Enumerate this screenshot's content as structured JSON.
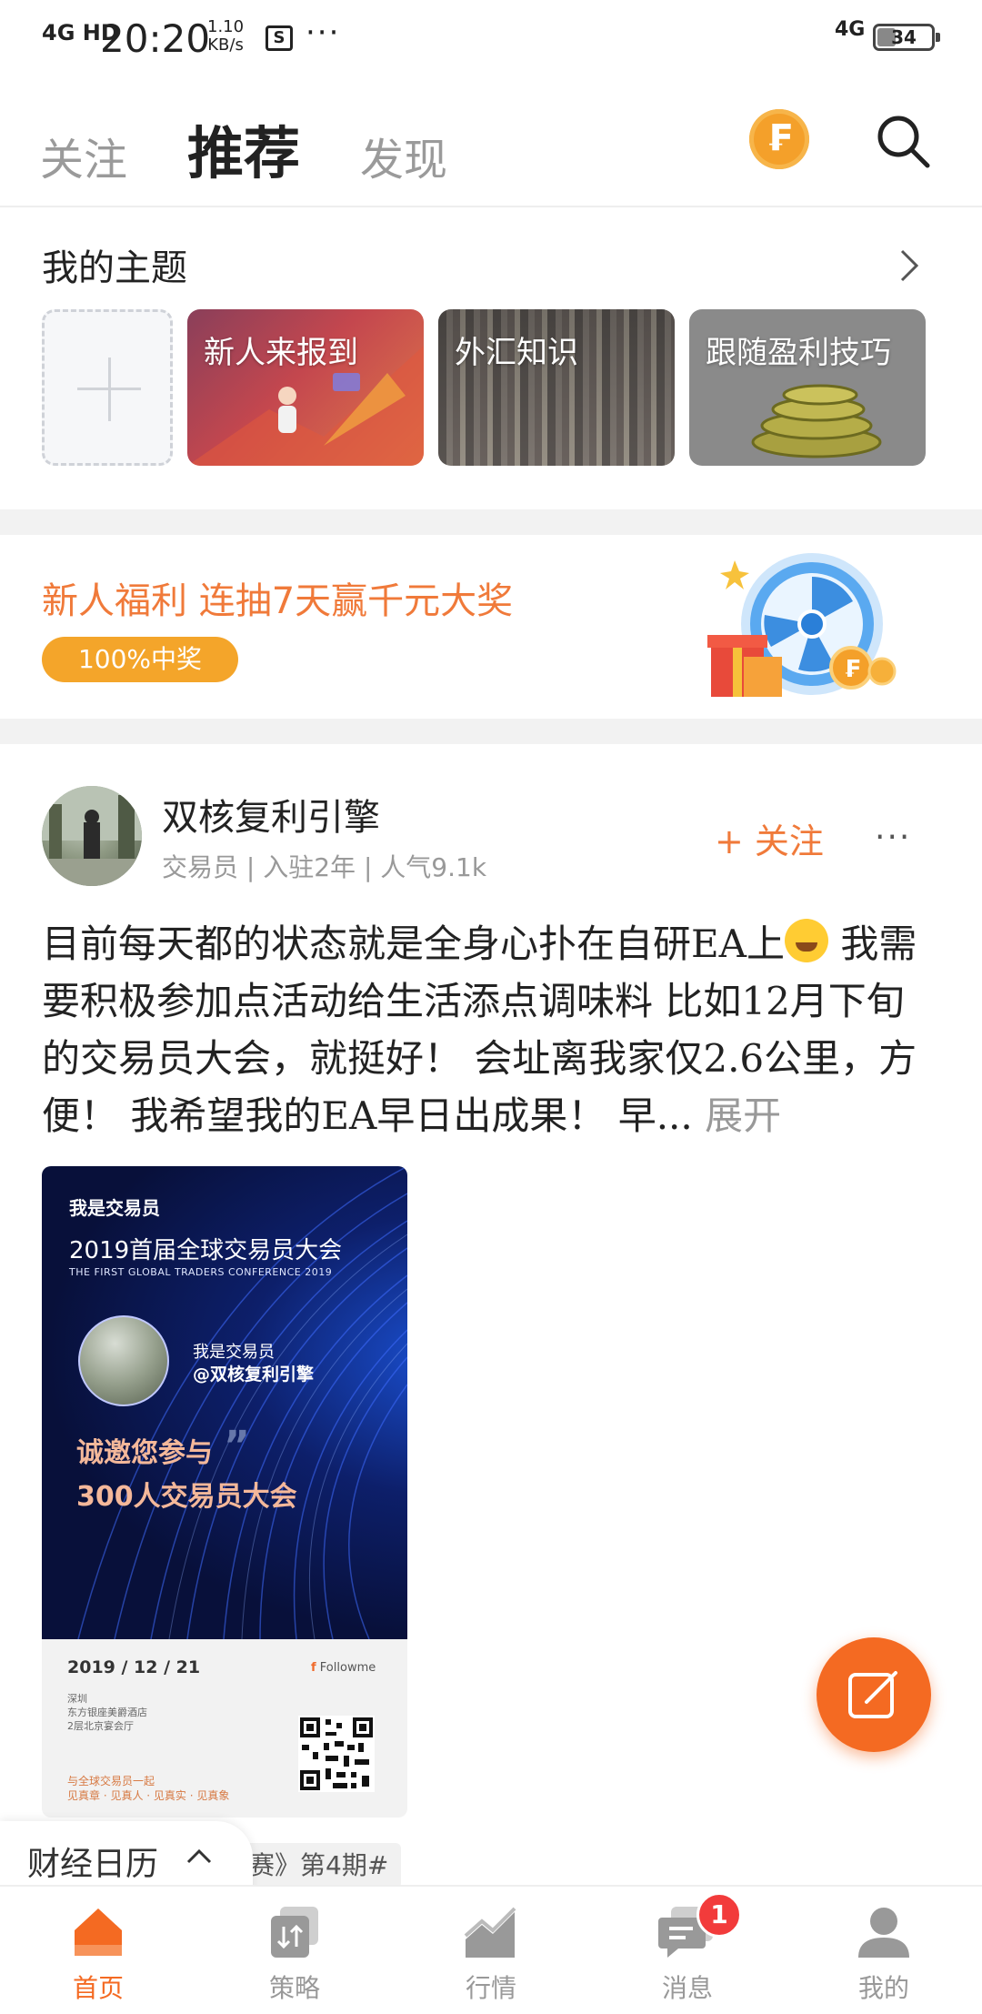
{
  "status_bar": {
    "signal": "4G HD",
    "time": "20:20",
    "speed_value": "1.10",
    "speed_unit": "KB/s",
    "s_icon": "S",
    "more": "···",
    "network": "4G",
    "battery": "34"
  },
  "header": {
    "tabs": [
      {
        "label": "关注",
        "active": false
      },
      {
        "label": "推荐",
        "active": true
      },
      {
        "label": "发现",
        "active": false
      }
    ],
    "coin_glyph": "₣",
    "icons": [
      "coin-icon",
      "search-icon"
    ]
  },
  "topics": {
    "title": "我的主题",
    "items": [
      {
        "label": "新人来报到"
      },
      {
        "label": "外汇知识"
      },
      {
        "label": "跟随盈利技巧"
      }
    ]
  },
  "banner": {
    "title": "新人福利 连抽7天赢千元大奖",
    "pill": "100%中奖"
  },
  "post": {
    "author": "双核复利引擎",
    "meta": "交易员 | 入驻2年 | 人气9.1k",
    "follow_label": "+ 关注",
    "more": "···",
    "text_part1": "目前每天都的状态就是全身心扑在自研EA上",
    "text_part2": " 我需要积极参加点活动给生活添点调味料 比如12月下旬的交易员大会，就挺好！ 会址离我家仅2.6公里，方便！ 我希望我的EA早日出成果！ 早...",
    "expand": "展开",
    "poster": {
      "logo": "我是交易员",
      "title": "2019首届全球交易员大会",
      "subtitle": "THE FIRST GLOBAL TRADERS CONFERENCE 2019",
      "line1": "我是交易员",
      "line2": "@双核复利引擎",
      "invite1": "诚邀您参与",
      "invite2": "300人交易员大会",
      "date": "2019 / 12 / 21",
      "venue": [
        "深圳",
        "东方银座美爵酒店",
        "2层北京宴会厅"
      ],
      "slogan": [
        "与全球交易员一起",
        "见真章 · 见真人 · 见真实 · 见真象"
      ],
      "brand": "Followme"
    },
    "tag_partial": "赛》第4期#"
  },
  "calendar": {
    "label": "财经日历"
  },
  "nav": [
    {
      "label": "首页",
      "active": true,
      "icon": "home-icon"
    },
    {
      "label": "策略",
      "active": false,
      "icon": "strategy-icon"
    },
    {
      "label": "行情",
      "active": false,
      "icon": "chart-icon"
    },
    {
      "label": "消息",
      "active": false,
      "icon": "message-icon",
      "badge": "1"
    },
    {
      "label": "我的",
      "active": false,
      "icon": "profile-icon"
    }
  ],
  "colors": {
    "accent": "#f46a22",
    "banner_text": "#f07a3a",
    "pill": "#f4a52a",
    "badge": "#f23b3b"
  }
}
